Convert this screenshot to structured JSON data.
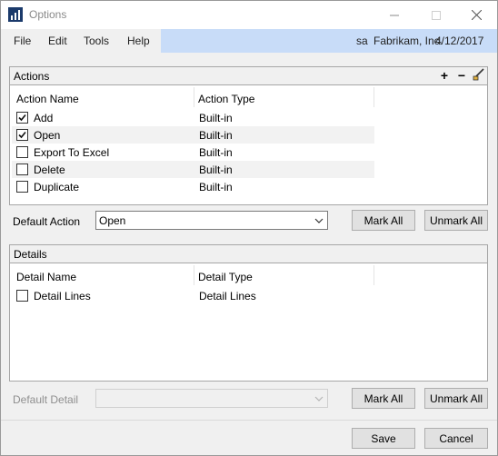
{
  "window": {
    "title": "Options"
  },
  "menu": {
    "file": "File",
    "edit": "Edit",
    "tools": "Tools",
    "help": "Help"
  },
  "context": {
    "user": "sa",
    "company": "Fabrikam, Inc.",
    "date": "4/12/2017"
  },
  "actions": {
    "title": "Actions",
    "icons": [
      "add-icon",
      "remove-icon",
      "edit-icon"
    ],
    "add_symbol": "+",
    "remove_symbol": "−",
    "col_name": "Action Name",
    "col_type": "Action Type",
    "rows": [
      {
        "name": "Add",
        "type": "Built-in",
        "checked": true
      },
      {
        "name": "Open",
        "type": "Built-in",
        "checked": true
      },
      {
        "name": "Export To Excel",
        "type": "Built-in",
        "checked": false
      },
      {
        "name": "Delete",
        "type": "Built-in",
        "checked": false
      },
      {
        "name": "Duplicate",
        "type": "Built-in",
        "checked": false
      }
    ],
    "default_label": "Default Action",
    "default_value": "Open",
    "mark_all": "Mark All",
    "unmark_all": "Unmark All"
  },
  "details": {
    "title": "Details",
    "col_name": "Detail Name",
    "col_type": "Detail Type",
    "rows": [
      {
        "name": "Detail Lines",
        "type": "Detail Lines",
        "checked": false
      }
    ],
    "default_label": "Default Detail",
    "default_value": "",
    "mark_all": "Mark All",
    "unmark_all": "Unmark All"
  },
  "footer": {
    "save": "Save",
    "cancel": "Cancel"
  },
  "colors": {
    "menu_context_bg": "#c8dcf8",
    "title_text": "#8a8a8a",
    "disabled_text": "#8f8f8f"
  }
}
